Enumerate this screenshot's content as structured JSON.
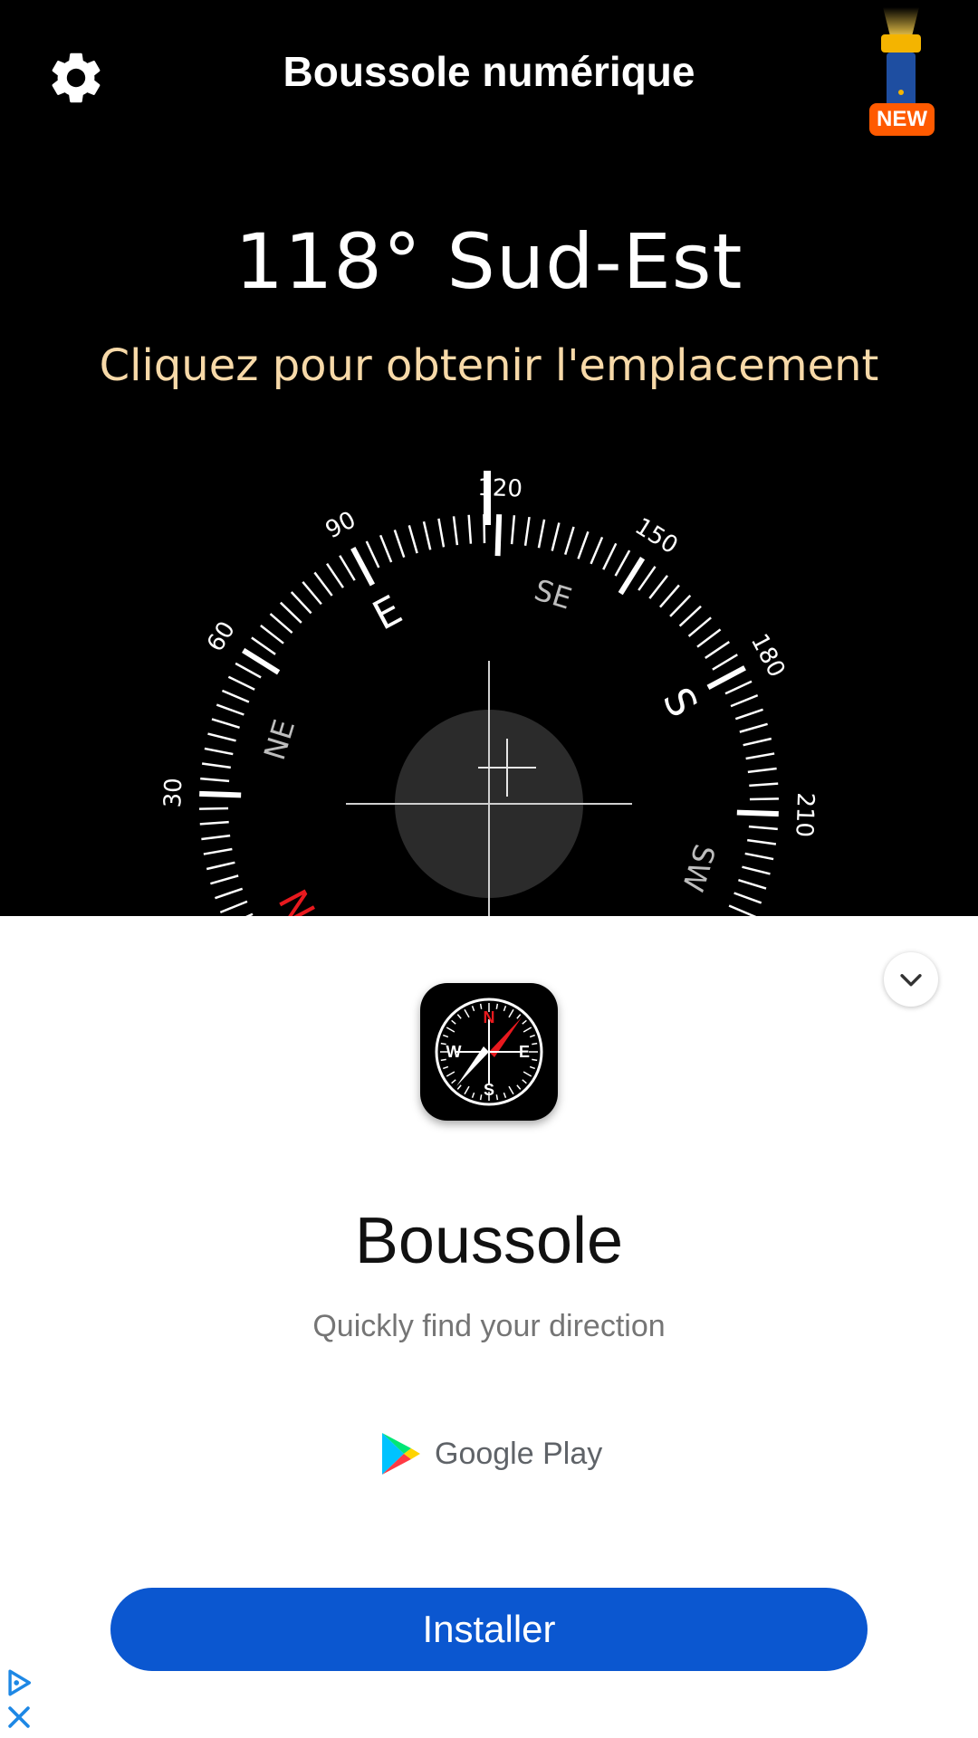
{
  "header": {
    "title": "Boussole numérique",
    "new_badge": "NEW"
  },
  "compass": {
    "heading_text": "118° Sud-Est",
    "location_prompt": "Cliquez pour obtenir l'emplacement",
    "current_heading_deg": 118,
    "degree_labels": [
      "30",
      "60",
      "90",
      "120",
      "150",
      "180",
      "210"
    ],
    "cardinal_labels": [
      "NE",
      "E",
      "SE",
      "S",
      "SW",
      "N"
    ],
    "north_color": "#e8191e",
    "accent_color": "#f7d9a8"
  },
  "ad": {
    "app_name": "Boussole",
    "tagline": "Quickly find your direction",
    "store": "Google Play",
    "install_label": "Installer",
    "app_icon_labels": {
      "n": "N",
      "e": "E",
      "s": "S",
      "w": "W"
    },
    "install_color": "#0b57d0"
  }
}
